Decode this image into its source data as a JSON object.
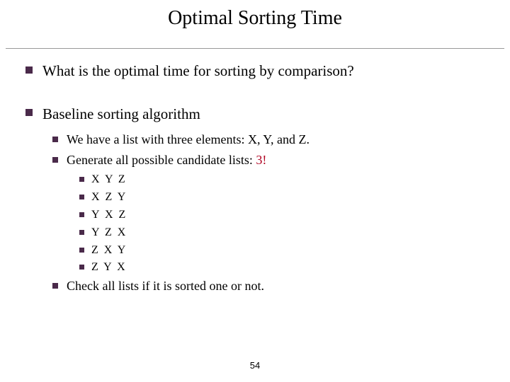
{
  "title": "Optimal Sorting Time",
  "bullets": {
    "q": "What is the optimal time for sorting by comparison?",
    "baseline": "Baseline sorting algorithm",
    "sub1": "We have a list with three elements: X, Y, and Z.",
    "sub2_pre": "Generate all possible candidate lists: ",
    "sub2_hl": "3!",
    "perm1": "X Y Z",
    "perm2": "X Z Y",
    "perm3": "Y X Z",
    "perm4": "Y Z X",
    "perm5": "Z X Y",
    "perm6": "Z Y X",
    "check": "Check all lists if it is sorted one or not."
  },
  "page": "54"
}
